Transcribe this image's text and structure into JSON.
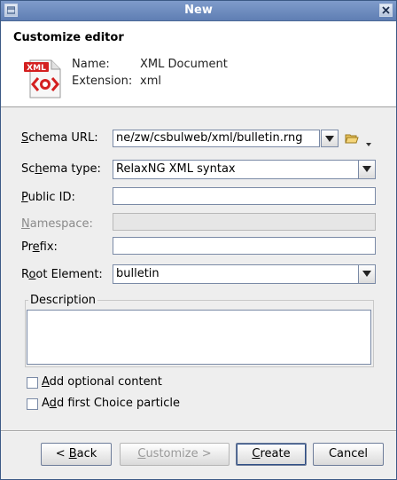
{
  "window": {
    "title": "New"
  },
  "header": {
    "title": "Customize editor",
    "icon_badge": "XML",
    "name_label": "Name:",
    "name_value": "XML Document",
    "extension_label": "Extension:",
    "extension_value": "xml"
  },
  "form": {
    "schema_url": {
      "label_pre": "",
      "label_ul": "S",
      "label_post": "chema URL:",
      "value": "ne/zw/csbulweb/xml/bulletin.rng"
    },
    "schema_type": {
      "label_pre": "Sc",
      "label_ul": "h",
      "label_post": "ema type:",
      "value": "RelaxNG XML syntax"
    },
    "public_id": {
      "label_pre": "",
      "label_ul": "P",
      "label_post": "ublic ID:",
      "value": ""
    },
    "namespace": {
      "label_pre": "",
      "label_ul": "N",
      "label_post": "amespace:",
      "value": ""
    },
    "prefix": {
      "label_pre": "Pr",
      "label_ul": "e",
      "label_post": "fix:",
      "value": ""
    },
    "root_element": {
      "label_pre": "R",
      "label_ul": "o",
      "label_post": "ot Element:",
      "value": "bulletin"
    },
    "description": {
      "legend": "Description",
      "value": ""
    }
  },
  "options": {
    "add_optional": {
      "label_pre": "",
      "label_ul": "A",
      "label_post": "dd optional content",
      "checked": false
    },
    "add_first_choice": {
      "label_pre": "A",
      "label_ul": "d",
      "label_post": "d first Choice particle",
      "checked": false
    }
  },
  "buttons": {
    "back": {
      "pre": "< ",
      "ul": "B",
      "post": "ack"
    },
    "customize": {
      "pre": "",
      "ul": "C",
      "post": "ustomize >"
    },
    "create": {
      "pre": "",
      "ul": "C",
      "post": "reate"
    },
    "cancel": {
      "label": "Cancel"
    }
  },
  "icons": {
    "window": "window-menu-icon",
    "close": "close-icon",
    "folder": "folder-open-icon",
    "doc": "xml-document-icon"
  },
  "colors": {
    "titlebar": "#6f8dc0",
    "xml_badge": "#d42020",
    "default_button_ring": "#2f4f86"
  }
}
